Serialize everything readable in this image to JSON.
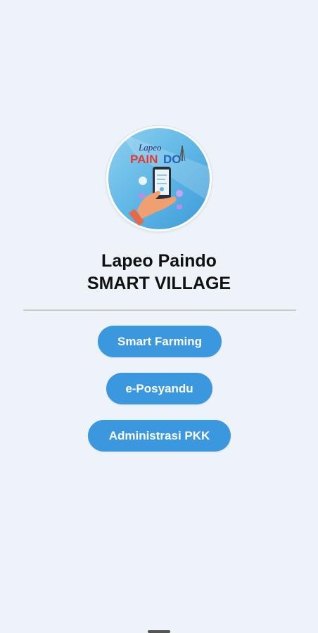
{
  "app": {
    "logo_wordmark": "Lapeo PAINDO",
    "title_line1": "Lapeo Paindo",
    "title_line2": "SMART VILLAGE"
  },
  "menu": {
    "buttons": [
      {
        "label": "Smart Farming"
      },
      {
        "label": "e-Posyandu"
      },
      {
        "label": "Administrasi PKK"
      }
    ]
  },
  "colors": {
    "background": "#eef3fa",
    "button": "#3b98de",
    "button_text": "#ffffff",
    "title_text": "#111111",
    "divider": "#c7cbd0"
  }
}
